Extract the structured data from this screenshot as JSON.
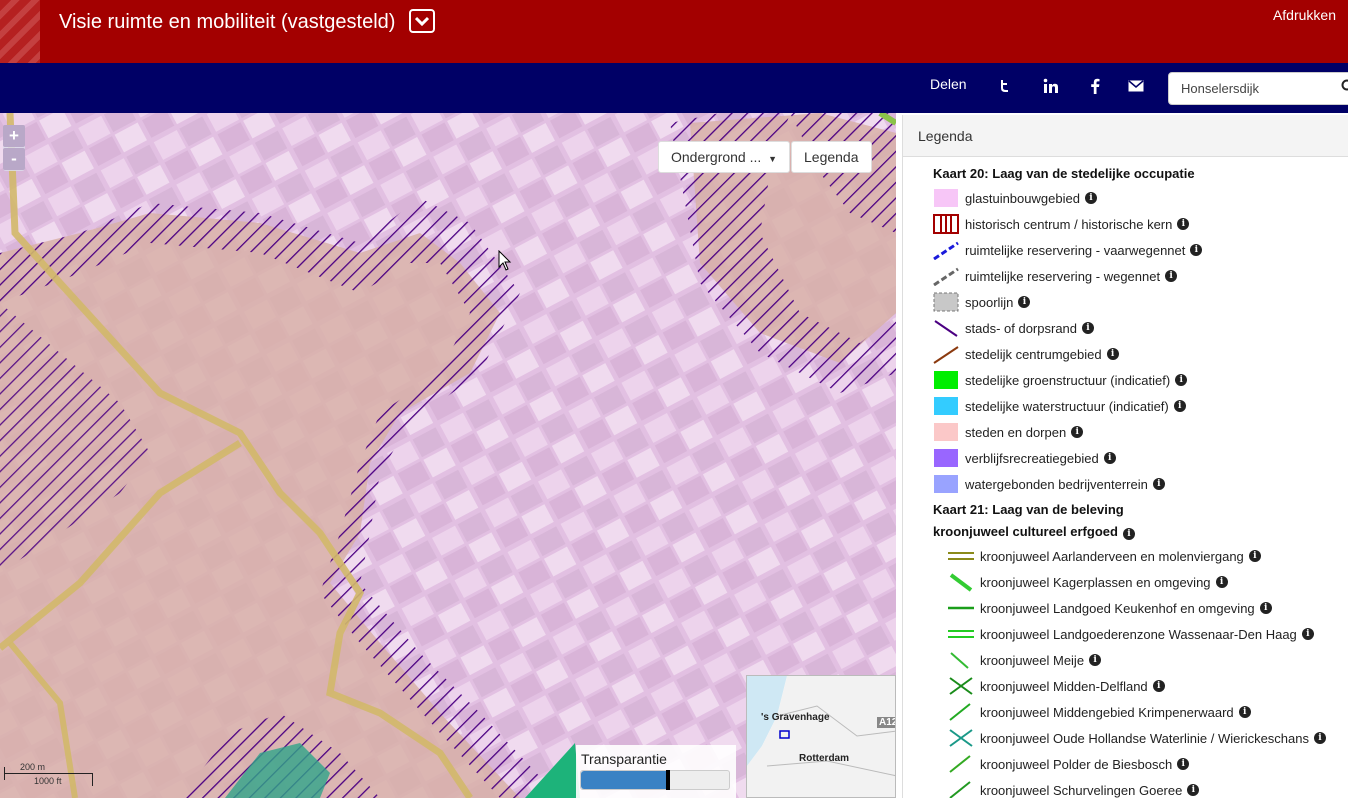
{
  "header": {
    "title": "Visie ruimte en mobiliteit (vastgesteld)",
    "print_label": "Afdrukken"
  },
  "nav": {
    "share_label": "Delen",
    "social": [
      "twitter-icon",
      "linkedin-icon",
      "facebook-icon",
      "mail-icon"
    ],
    "search_value": "Honselersdijk"
  },
  "map": {
    "zoom_in": "+",
    "zoom_out": "-",
    "basemap_button": "Ondergrond ...",
    "legend_button": "Legenda",
    "scale_m": "200 m",
    "scale_ft": "1000 ft",
    "transparency_label": "Transparantie",
    "transparency_value": 0.59,
    "overview": {
      "city1": "'s Gravenhage",
      "city2": "Rotterdam",
      "road": "A12"
    }
  },
  "legend": {
    "title": "Legenda",
    "section1": "Kaart 20: Laag van de stedelijke occupatie",
    "items1": [
      {
        "label": "glastuinbouwgebied",
        "color": "#f7c6f7"
      },
      {
        "label": "historisch centrum / historische kern",
        "color": "#a30000"
      },
      {
        "label": "ruimtelijke reservering - vaarwegennet",
        "color": "#1a1adb"
      },
      {
        "label": "ruimtelijke reservering - wegennet",
        "color": "#666666"
      },
      {
        "label": "spoorlijn",
        "color": "#c8c8c8"
      },
      {
        "label": "stads- of dorpsrand",
        "color": "#4b0082"
      },
      {
        "label": "stedelijk centrumgebied",
        "color": "#8b3a0f"
      },
      {
        "label": "stedelijke groenstructuur (indicatief)",
        "color": "#00ee00"
      },
      {
        "label": "stedelijke waterstructuur (indicatief)",
        "color": "#33ccff"
      },
      {
        "label": "steden en dorpen",
        "color": "#fbc8c8"
      },
      {
        "label": "verblijfsrecreatiegebied",
        "color": "#9966ff"
      },
      {
        "label": "watergebonden bedrijventerrein",
        "color": "#99a3ff"
      }
    ],
    "section2": "Kaart 21: Laag van de beleving",
    "subsection": "kroonjuweel cultureel erfgoed",
    "items2": [
      {
        "label": "kroonjuweel Aarlanderveen en molenviergang",
        "color": "#8a8a1a"
      },
      {
        "label": "kroonjuweel Kagerplassen en omgeving",
        "color": "#33cc33"
      },
      {
        "label": "kroonjuweel Landgoed Keukenhof en omgeving",
        "color": "#1a9e1a"
      },
      {
        "label": "kroonjuweel Landgoederenzone Wassenaar-Den Haag",
        "color": "#22cc22"
      },
      {
        "label": "kroonjuweel Meije",
        "color": "#33bb33"
      },
      {
        "label": "kroonjuweel Midden-Delfland",
        "color": "#1a8c1a"
      },
      {
        "label": "kroonjuweel Middengebied Krimpenerwaard",
        "color": "#22aa22"
      },
      {
        "label": "kroonjuweel Oude Hollandse Waterlinie / Wierickeschans",
        "color": "#1a9988"
      },
      {
        "label": "kroonjuweel Polder de Biesbosch",
        "color": "#33aa22"
      },
      {
        "label": "kroonjuweel Schurvelingen Goeree",
        "color": "#229922"
      }
    ]
  }
}
